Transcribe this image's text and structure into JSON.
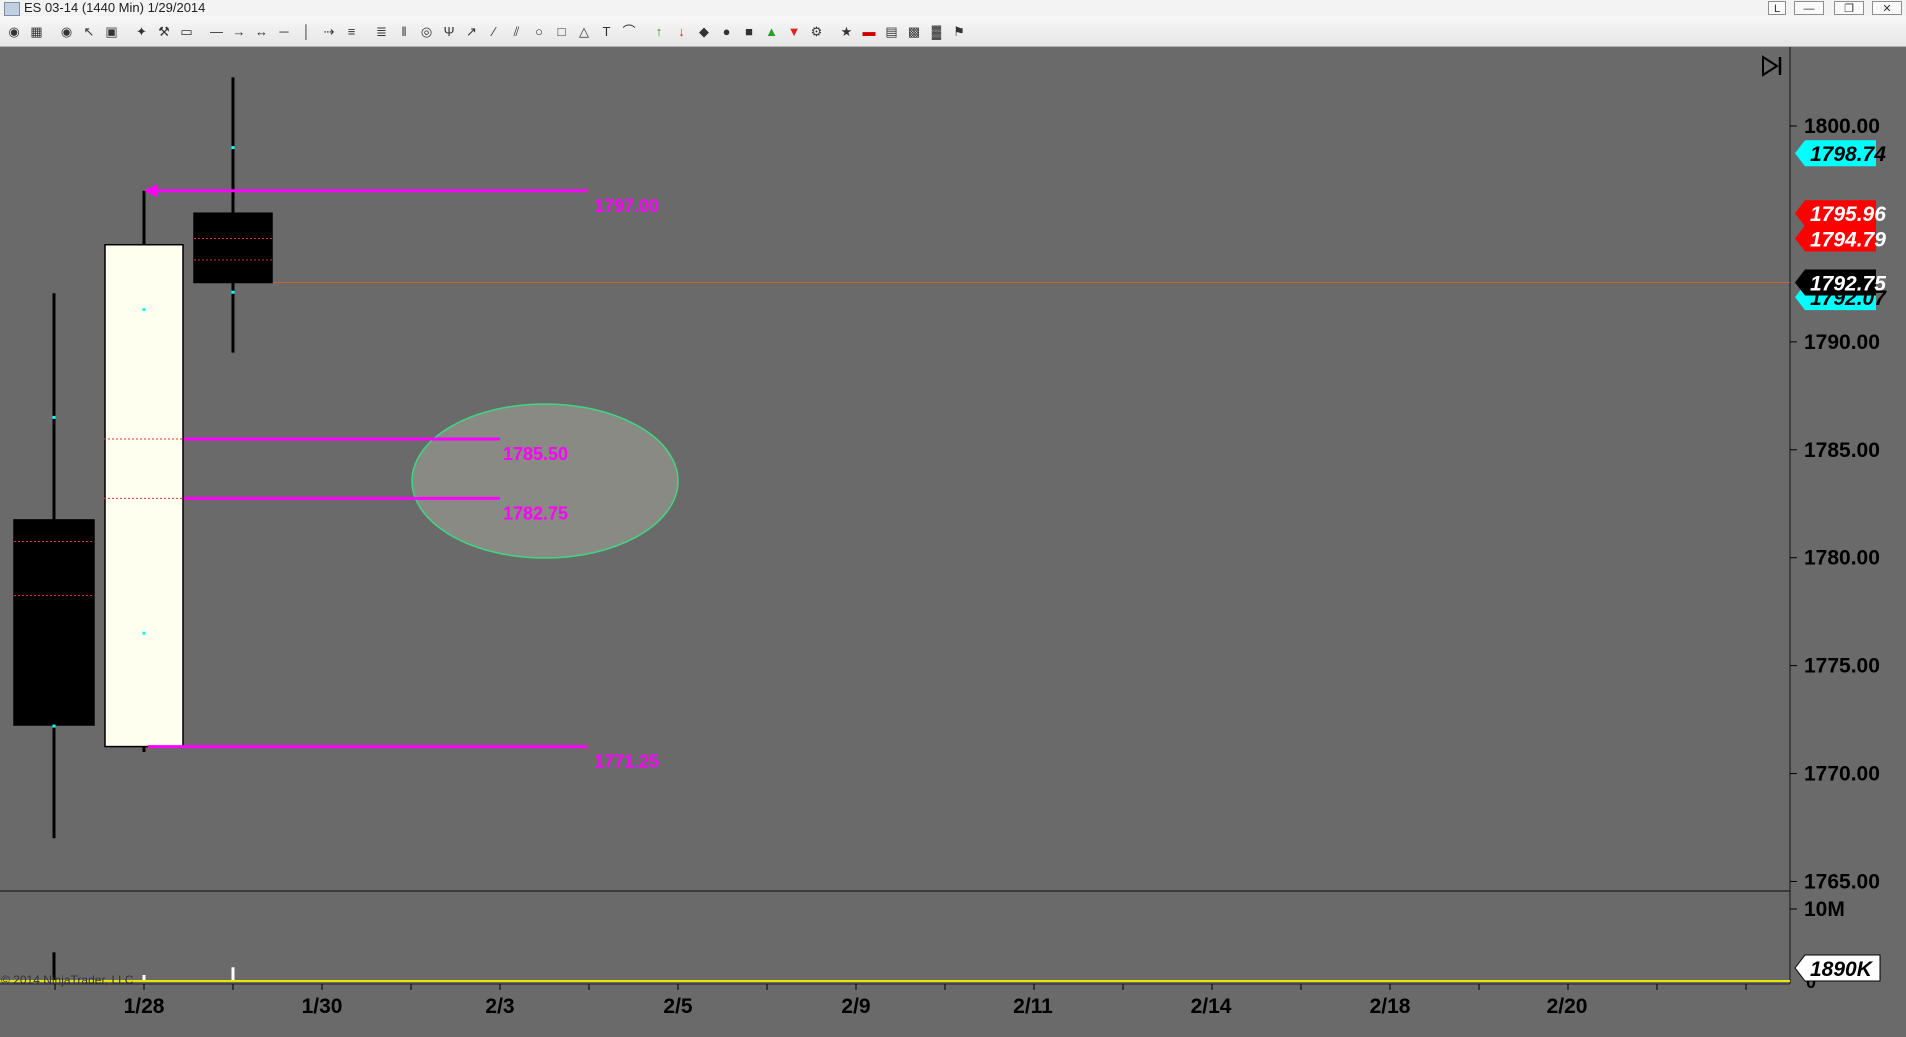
{
  "window": {
    "title": "ES 03-14 (1440 Min)  1/29/2014",
    "controls": [
      "L",
      "—",
      "❐",
      "✕"
    ]
  },
  "toolbar": {
    "icons": [
      "eye-icon",
      "data-series-icon",
      "eye-icon",
      "cursor-icon",
      "properties-icon",
      "crosshair-icon",
      "hammer-icon",
      "highlighter-icon",
      "line-tool-icon",
      "ray-tool-icon",
      "extended-line-icon",
      "horizontal-line-icon",
      "vertical-line-icon",
      "arrow-line-icon",
      "fib-retracement-icon",
      "fib-extension-icon",
      "fib-time-icon",
      "fib-circle-icon",
      "pitchfork-icon",
      "gann-fan-icon",
      "regression-icon",
      "trend-channel-icon",
      "ellipse-icon",
      "rectangle-icon",
      "triangle-icon",
      "text-icon",
      "arc-icon",
      "arrow-up-icon",
      "arrow-down-icon",
      "diamond-icon",
      "dot-icon",
      "square-icon",
      "triangle-up-icon",
      "triangle-down-icon",
      "strategy-icon",
      "ninja-icon",
      "remove-icon",
      "data-box-icon",
      "chart-trader-icon",
      "bar-type-icon",
      "alert-icon"
    ]
  },
  "chart_data": {
    "type": "candlestick",
    "instrument": "ES 03-14",
    "bars": [
      {
        "date": "1/27",
        "open": 1781.75,
        "high": 1792.25,
        "low": 1767.0,
        "close": 1772.25
      },
      {
        "date": "1/28",
        "open": 1771.25,
        "high": 1797.0,
        "low": 1771.0,
        "close": 1794.5
      },
      {
        "date": "1/29",
        "open": 1795.96,
        "high": 1802.25,
        "low": 1789.5,
        "close": 1792.75
      }
    ],
    "volume": {
      "scale_label": "10M",
      "value_label": "1890K",
      "zero_label": "0",
      "bars": [
        {
          "date": "1/27",
          "value": 3800000
        },
        {
          "date": "1/28",
          "value": 900000
        },
        {
          "date": "1/29",
          "value": 1890000
        }
      ]
    },
    "price_axis": {
      "min": 1762.5,
      "max": 1803.0,
      "ticks": [
        "1800.00",
        "1790.00",
        "1785.00",
        "1780.00",
        "1775.00",
        "1770.00",
        "1765.00"
      ]
    },
    "x_labels": [
      "1/28",
      "1/30",
      "2/3",
      "2/5",
      "2/9",
      "2/11",
      "2/14",
      "2/18",
      "2/20"
    ],
    "price_markers": [
      {
        "label": "1798.74",
        "value": 1798.74,
        "bg": "#00ffff",
        "fg": "#000000"
      },
      {
        "label": "1795.96",
        "value": 1795.96,
        "bg": "#ff0000",
        "fg": "#ffffff"
      },
      {
        "label": "1794.79",
        "value": 1794.79,
        "bg": "#ff0000",
        "fg": "#ffffff"
      },
      {
        "label": "1792.07",
        "value": 1792.07,
        "bg": "#00ffff",
        "fg": "#000000"
      },
      {
        "label": "1792.75",
        "value": 1792.75,
        "bg": "#000000",
        "fg": "#ffffff"
      }
    ],
    "levels": [
      {
        "label": "1797.00",
        "value": 1797.0
      },
      {
        "label": "1785.50",
        "value": 1785.5
      },
      {
        "label": "1782.75",
        "value": 1782.75
      },
      {
        "label": "1771.25",
        "value": 1771.25
      }
    ],
    "copyright": "© 2014 NinjaTrader, LLC"
  },
  "colors": {
    "background": "#6a6a6a",
    "up_candle": "#fffff0",
    "down_candle": "#000000",
    "level_line": "#ff00ff",
    "volume_line": "#e8e800",
    "ellipse_stroke": "#3ddc84",
    "last_price_line": "#c8652a"
  }
}
